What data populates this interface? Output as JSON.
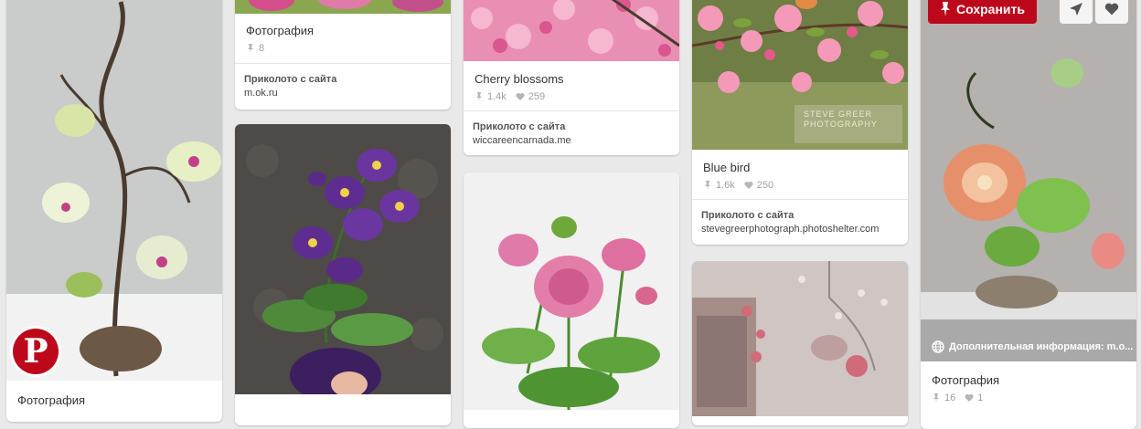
{
  "pins": [
    {
      "title": "Фотография",
      "repins": "",
      "likes": "",
      "source_label": "",
      "source_url": ""
    },
    {
      "title": "Фотография",
      "repins": "8",
      "likes": "",
      "source_label": "Приколото с сайта",
      "source_url": "m.ok.ru"
    },
    {
      "title": "",
      "repins": "",
      "likes": "",
      "source_label": "",
      "source_url": ""
    },
    {
      "title": "Cherry blossoms",
      "repins": "1.4k",
      "likes": "259",
      "source_label": "Приколото с сайта",
      "source_url": "wiccareencarnada.me"
    },
    {
      "title": "",
      "repins": "",
      "likes": "",
      "source_label": "",
      "source_url": ""
    },
    {
      "title": "Blue bird",
      "repins": "1.6k",
      "likes": "250",
      "source_label": "Приколото с сайта",
      "source_url": "stevegreerphotograph.photoshelter.com"
    },
    {
      "title": "",
      "repins": "",
      "likes": "",
      "source_label": "",
      "source_url": ""
    },
    {
      "title": "Фотография",
      "repins": "16",
      "likes": "1",
      "source_label": "",
      "source_url": ""
    }
  ],
  "hover_pin": {
    "save_label": "Сохранить",
    "more_info": "Дополнительная информация: m.o...",
    "send_icon": "send-icon",
    "like_icon": "heart-icon"
  },
  "image_watermark": "STEVE GREER PHOTOGRAPHY",
  "logo": "P",
  "colors": {
    "save_red": "#bd081c",
    "background": "#e9e9e9"
  }
}
